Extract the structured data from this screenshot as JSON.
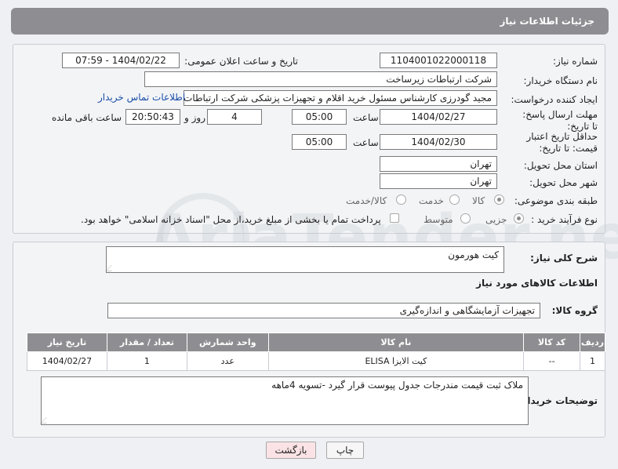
{
  "header": {
    "title": "جزئیات اطلاعات نیاز"
  },
  "form": {
    "need_number_label": "شماره نیاز:",
    "need_number": "1104001022000118",
    "announce_label": "تاریخ و ساعت اعلان عمومی:",
    "announce_value": "1404/02/22 - 07:59",
    "buyer_label": "نام دستگاه خریدار:",
    "buyer_value": "شرکت ارتباطات زیرساخت",
    "creator_label": "ایجاد کننده درخواست:",
    "creator_value": "مجید گودرزی کارشناس مسئول خرید اقلام و تجهیزات پزشکی شرکت ارتباطات ز",
    "contact_link": "اطلاعات تماس خریدار",
    "deadline_label": "مهلت ارسال پاسخ: تا تاریخ:",
    "deadline_date": "1404/02/27",
    "time_label": "ساعت",
    "deadline_time": "05:00",
    "days_value": "4",
    "days_label": "روز و",
    "remaining_value": "20:50:43",
    "remaining_label": "ساعت باقی مانده",
    "validity_label": "حداقل تاریخ اعتبار قیمت: تا تاریخ:",
    "validity_date": "1404/02/30",
    "validity_time_label": "ساعت",
    "validity_time": "05:00",
    "province_label": "استان محل تحویل:",
    "province_value": "تهران",
    "city_label": "شهر محل تحویل:",
    "city_value": "تهران",
    "category_label": "طبقه بندی موضوعی:",
    "category_options": [
      "کالا",
      "خدمت",
      "کالا/خدمت"
    ],
    "category_selected": "کالا",
    "process_label": "نوع فرآیند خرید :",
    "process_options": [
      "جزیی",
      "متوسط"
    ],
    "process_selected": "جزیی",
    "payment_note": "پرداخت تمام یا بخشی از مبلغ خرید،از محل \"اسناد خزانه اسلامی\" خواهد بود."
  },
  "summary": {
    "label": "شرح کلی نیاز:",
    "value": "کیت هورمون"
  },
  "goods": {
    "section_title": "اطلاعات کالاهای مورد نیاز",
    "group_label": "گروه کالا:",
    "group_value": "تجهیزات آزمایشگاهی و اندازه‌گیری",
    "columns": [
      "ردیف",
      "کد کالا",
      "نام کالا",
      "واحد شمارش",
      "تعداد / مقدار",
      "تاریخ نیاز"
    ],
    "rows": [
      [
        "1",
        "--",
        "کیت الایزا ELISA",
        "عدد",
        "1",
        "1404/02/27"
      ]
    ]
  },
  "notes": {
    "label": "توضیحات خریدار:",
    "value": "ملاک ثبت قیمت مندرجات جدول پیوست قرار گیرد -تسویه 4ماهه"
  },
  "buttons": {
    "print": "چاپ",
    "back": "بازگشت"
  },
  "watermark": {
    "text": "AriaTender.neT"
  },
  "colors": {
    "header_bg": "#8e8e92",
    "link": "#1a4ea8",
    "back_button_bg": "#fbe3e5"
  }
}
